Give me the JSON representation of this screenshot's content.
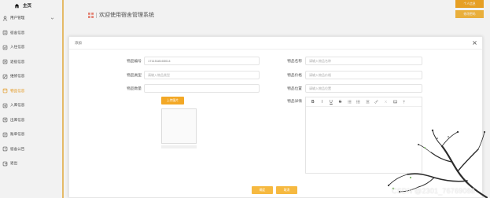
{
  "sidebar": {
    "home_label": "主页",
    "items": [
      {
        "label": "用户管理",
        "icon": "user-icon",
        "expandable": true
      },
      {
        "label": "宿舍信息",
        "icon": "building-icon"
      },
      {
        "label": "入住信息",
        "icon": "checkin-icon"
      },
      {
        "label": "退宿信息",
        "icon": "checkout-icon"
      },
      {
        "label": "维修信息",
        "icon": "wrench-icon"
      },
      {
        "label": "物品信息",
        "icon": "box-icon",
        "active": true
      },
      {
        "label": "入库信息",
        "icon": "inbox-icon"
      },
      {
        "label": "出库信息",
        "icon": "outbox-icon"
      },
      {
        "label": "账单信息",
        "icon": "bill-icon"
      },
      {
        "label": "宿舍公告",
        "icon": "notice-icon"
      },
      {
        "label": "退出",
        "icon": "logout-icon"
      }
    ]
  },
  "header": {
    "title": "欢迎使用宿舍管理系统",
    "buttons": [
      "个人信息",
      "修改密码"
    ]
  },
  "dialog": {
    "title": "添加",
    "fields_left": [
      {
        "label": "物品编号",
        "value": "1711518165014",
        "placeholder": ""
      },
      {
        "label": "物品类型",
        "value": "",
        "placeholder": "请输入物品类型"
      },
      {
        "label": "物品数量",
        "value": "",
        "placeholder": ""
      }
    ],
    "fields_right": [
      {
        "label": "物品名称",
        "value": "",
        "placeholder": "请输入物品名称"
      },
      {
        "label": "物品价格",
        "value": "",
        "placeholder": "请输入物品价格"
      },
      {
        "label": "物品位置",
        "value": "",
        "placeholder": "请输入物品位置"
      }
    ],
    "upload_label": "上传图片",
    "detail_label": "物品详情",
    "toolbar": [
      "B",
      "I",
      "U",
      "S"
    ],
    "confirm": "确定",
    "cancel": "取消"
  },
  "watermark": "CSDN @2301_76769088",
  "colors": {
    "accent": "#f3a826",
    "active_text": "#f0a020",
    "sidebar_border": "#f2c46d"
  }
}
